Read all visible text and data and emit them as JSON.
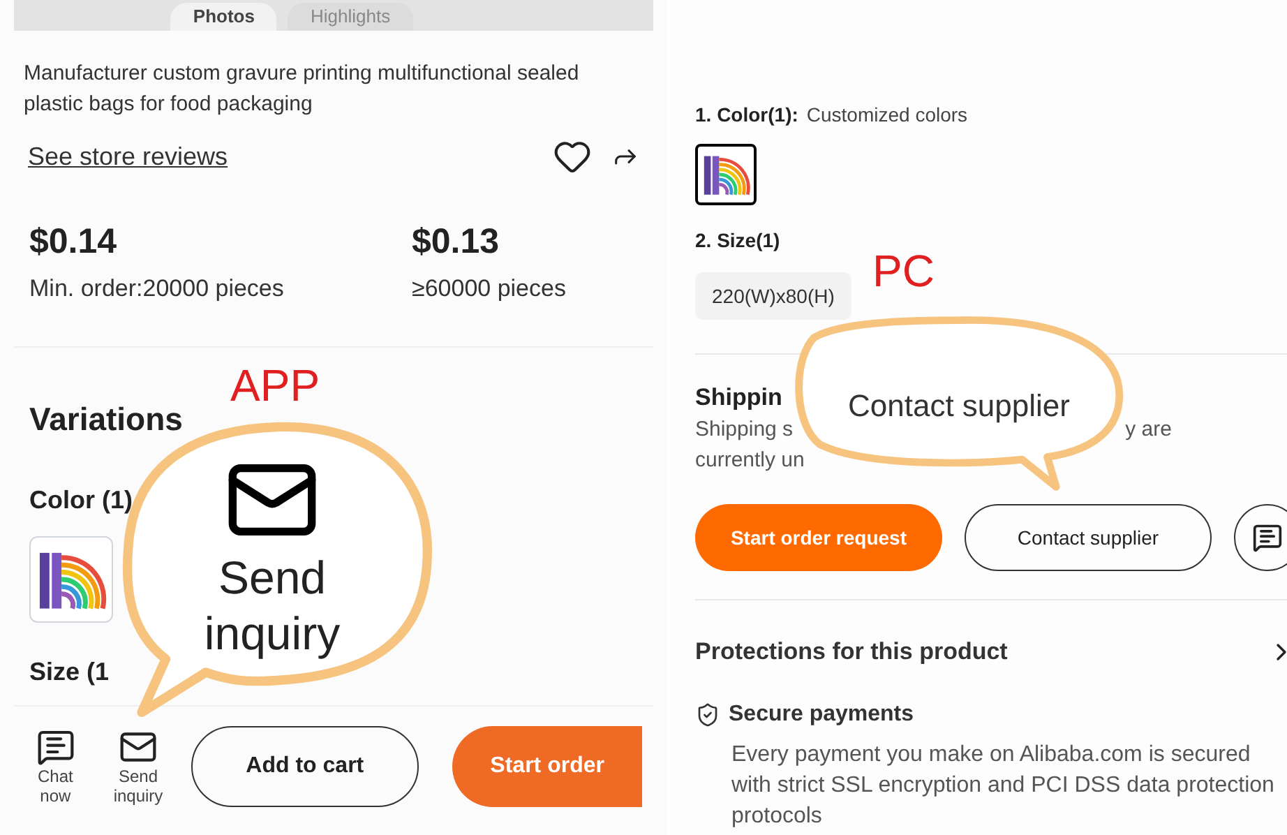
{
  "app_panel": {
    "label": "APP",
    "tabs": [
      {
        "label": "Photos",
        "selected": true
      },
      {
        "label": "Highlights",
        "selected": false
      }
    ],
    "title": "Manufacturer custom gravure printing multifunctional sealed plastic bags for food packaging",
    "reviews_link": "See store reviews",
    "prices": [
      {
        "price": "$0.14",
        "quantity": "Min. order:20000 pieces"
      },
      {
        "price": "$0.13",
        "quantity": "≥60000 pieces"
      }
    ],
    "variations_heading": "Variations",
    "color_label": "Color (1)",
    "color_options": [
      {
        "selected": false
      }
    ],
    "size_label": "Size (1",
    "actions": [
      {
        "kind": "chat",
        "label": "Chat now"
      },
      {
        "kind": "mail",
        "label": "Send inquiry"
      }
    ],
    "buttons": [
      {
        "kind": "outline",
        "label": "Add to cart"
      },
      {
        "kind": "primary",
        "label": "Start order"
      }
    ],
    "callout": {
      "text": "Send inquiry"
    }
  },
  "pc_panel": {
    "label": "PC",
    "color_label": "1. Color(1):",
    "color_value": "Customized colors",
    "color_options": [
      {
        "selected": true
      }
    ],
    "size_label": "2. Size(1)",
    "size_options": [
      {
        "label": "220(W)x80(H)",
        "selected": false
      }
    ],
    "shipping_heading": "Shippin",
    "shipping_text": [
      "Shipping s",
      "y are",
      "currently un"
    ],
    "buttons": [
      {
        "kind": "primary",
        "label": "Start order request"
      },
      {
        "kind": "outline",
        "label": "Contact supplier"
      },
      {
        "kind": "chat-icon"
      }
    ],
    "protections_heading": "Protections for this product",
    "protection": {
      "title": "Secure payments",
      "text": "Every payment you make on Alibaba.com is secured with strict SSL encryption and PCI DSS data protection protocols"
    },
    "callout": {
      "text": "Contact supplier"
    }
  }
}
